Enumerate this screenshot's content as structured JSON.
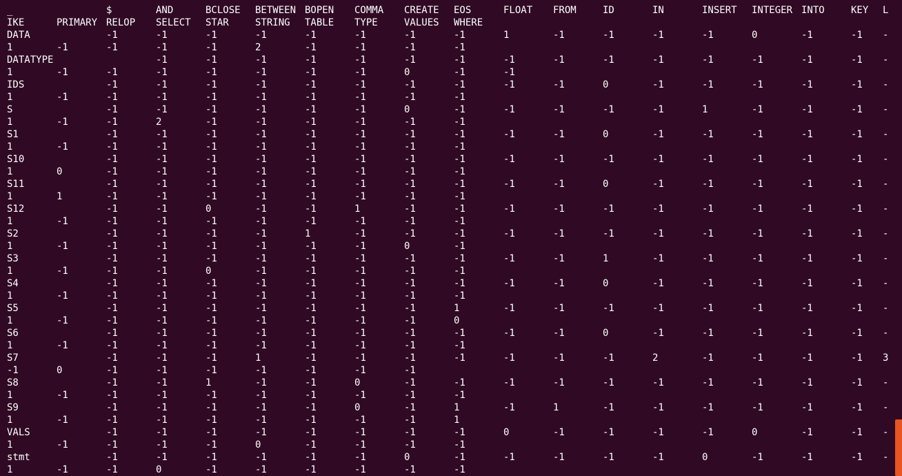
{
  "colors": {
    "background": "#300a24",
    "text": "#ffffff",
    "scrollbar": "#e95420"
  },
  "lines": [
    {
      "type": "header",
      "cells": [
        "_",
        "",
        "$",
        "AND",
        "BCLOSE",
        "BETWEEN",
        "BOPEN",
        "COMMA",
        "CREATE",
        "EOS",
        "FLOAT",
        "FROM",
        "ID",
        "IN",
        "INSERT",
        "INTEGER",
        "INTO",
        "KEY",
        "L"
      ]
    },
    {
      "type": "header",
      "cells": [
        "IKE",
        "PRIMARY",
        "RELOP",
        "SELECT",
        "STAR",
        "STRING",
        "TABLE",
        "TYPE",
        "VALUES",
        "WHERE"
      ]
    },
    {
      "type": "row-a",
      "cells": [
        "DATA",
        "",
        "-1",
        "-1",
        "-1",
        "-1",
        "-1",
        "-1",
        "-1",
        "-1",
        "1",
        "-1",
        "-1",
        "-1",
        "-1",
        "0",
        "-1",
        "-1",
        "-"
      ]
    },
    {
      "type": "row-b",
      "cells": [
        "1",
        "-1",
        "-1",
        "-1",
        "-1",
        "2",
        "-1",
        "-1",
        "-1",
        "-1"
      ]
    },
    {
      "type": "row-a",
      "cells": [
        "DATATYPE",
        "",
        "",
        "-1",
        "-1",
        "-1",
        "-1",
        "-1",
        "-1",
        "-1",
        "-1",
        "-1",
        "-1",
        "-1",
        "-1",
        "-1",
        "-1",
        "-1",
        "-"
      ]
    },
    {
      "type": "row-b",
      "cells": [
        "1",
        "-1",
        "-1",
        "-1",
        "-1",
        "-1",
        "-1",
        "-1",
        "0",
        "-1",
        "-1"
      ]
    },
    {
      "type": "row-a",
      "cells": [
        "IDS",
        "",
        "-1",
        "-1",
        "-1",
        "-1",
        "-1",
        "-1",
        "-1",
        "-1",
        "-1",
        "-1",
        "0",
        "-1",
        "-1",
        "-1",
        "-1",
        "-1",
        "-"
      ]
    },
    {
      "type": "row-b",
      "cells": [
        "1",
        "-1",
        "-1",
        "-1",
        "-1",
        "-1",
        "-1",
        "-1",
        "-1",
        "-1"
      ]
    },
    {
      "type": "row-a",
      "cells": [
        "S",
        "",
        "-1",
        "-1",
        "-1",
        "-1",
        "-1",
        "-1",
        "0",
        "-1",
        "-1",
        "-1",
        "-1",
        "-1",
        "1",
        "-1",
        "-1",
        "-1",
        "-"
      ]
    },
    {
      "type": "row-b",
      "cells": [
        "1",
        "-1",
        "-1",
        "2",
        "-1",
        "-1",
        "-1",
        "-1",
        "-1",
        "-1"
      ]
    },
    {
      "type": "row-a",
      "cells": [
        "S1",
        "",
        "-1",
        "-1",
        "-1",
        "-1",
        "-1",
        "-1",
        "-1",
        "-1",
        "-1",
        "-1",
        "0",
        "-1",
        "-1",
        "-1",
        "-1",
        "-1",
        "-"
      ]
    },
    {
      "type": "row-b",
      "cells": [
        "1",
        "-1",
        "-1",
        "-1",
        "-1",
        "-1",
        "-1",
        "-1",
        "-1",
        "-1"
      ]
    },
    {
      "type": "row-a",
      "cells": [
        "S10",
        "",
        "-1",
        "-1",
        "-1",
        "-1",
        "-1",
        "-1",
        "-1",
        "-1",
        "-1",
        "-1",
        "-1",
        "-1",
        "-1",
        "-1",
        "-1",
        "-1",
        "-"
      ]
    },
    {
      "type": "row-b",
      "cells": [
        "1",
        "0",
        "-1",
        "-1",
        "-1",
        "-1",
        "-1",
        "-1",
        "-1",
        "-1"
      ]
    },
    {
      "type": "row-a",
      "cells": [
        "S11",
        "",
        "-1",
        "-1",
        "-1",
        "-1",
        "-1",
        "-1",
        "-1",
        "-1",
        "-1",
        "-1",
        "0",
        "-1",
        "-1",
        "-1",
        "-1",
        "-1",
        "-"
      ]
    },
    {
      "type": "row-b",
      "cells": [
        "1",
        "1",
        "-1",
        "-1",
        "-1",
        "-1",
        "-1",
        "-1",
        "-1",
        "-1"
      ]
    },
    {
      "type": "row-a",
      "cells": [
        "S12",
        "",
        "-1",
        "-1",
        "0",
        "-1",
        "-1",
        "1",
        "-1",
        "-1",
        "-1",
        "-1",
        "-1",
        "-1",
        "-1",
        "-1",
        "-1",
        "-1",
        "-"
      ]
    },
    {
      "type": "row-b",
      "cells": [
        "1",
        "-1",
        "-1",
        "-1",
        "-1",
        "-1",
        "-1",
        "-1",
        "-1",
        "-1"
      ]
    },
    {
      "type": "row-a",
      "cells": [
        "S2",
        "",
        "-1",
        "-1",
        "-1",
        "-1",
        "1",
        "-1",
        "-1",
        "-1",
        "-1",
        "-1",
        "-1",
        "-1",
        "-1",
        "-1",
        "-1",
        "-1",
        "-"
      ]
    },
    {
      "type": "row-b",
      "cells": [
        "1",
        "-1",
        "-1",
        "-1",
        "-1",
        "-1",
        "-1",
        "-1",
        "0",
        "-1"
      ]
    },
    {
      "type": "row-a",
      "cells": [
        "S3",
        "",
        "-1",
        "-1",
        "-1",
        "-1",
        "-1",
        "-1",
        "-1",
        "-1",
        "-1",
        "-1",
        "1",
        "-1",
        "-1",
        "-1",
        "-1",
        "-1",
        "-"
      ]
    },
    {
      "type": "row-b",
      "cells": [
        "1",
        "-1",
        "-1",
        "-1",
        "0",
        "-1",
        "-1",
        "-1",
        "-1",
        "-1"
      ]
    },
    {
      "type": "row-a",
      "cells": [
        "S4",
        "",
        "-1",
        "-1",
        "-1",
        "-1",
        "-1",
        "-1",
        "-1",
        "-1",
        "-1",
        "-1",
        "0",
        "-1",
        "-1",
        "-1",
        "-1",
        "-1",
        "-"
      ]
    },
    {
      "type": "row-b",
      "cells": [
        "1",
        "-1",
        "-1",
        "-1",
        "-1",
        "-1",
        "-1",
        "-1",
        "-1",
        "-1"
      ]
    },
    {
      "type": "row-a",
      "cells": [
        "S5",
        "",
        "-1",
        "-1",
        "-1",
        "-1",
        "-1",
        "-1",
        "-1",
        "1",
        "-1",
        "-1",
        "-1",
        "-1",
        "-1",
        "-1",
        "-1",
        "-1",
        "-"
      ]
    },
    {
      "type": "row-b",
      "cells": [
        "1",
        "-1",
        "-1",
        "-1",
        "-1",
        "-1",
        "-1",
        "-1",
        "-1",
        "0"
      ]
    },
    {
      "type": "row-a",
      "cells": [
        "S6",
        "",
        "-1",
        "-1",
        "-1",
        "-1",
        "-1",
        "-1",
        "-1",
        "-1",
        "-1",
        "-1",
        "0",
        "-1",
        "-1",
        "-1",
        "-1",
        "-1",
        "-"
      ]
    },
    {
      "type": "row-b",
      "cells": [
        "1",
        "-1",
        "-1",
        "-1",
        "-1",
        "-1",
        "-1",
        "-1",
        "-1",
        "-1"
      ]
    },
    {
      "type": "row-a",
      "cells": [
        "S7",
        "",
        "-1",
        "-1",
        "-1",
        "1",
        "-1",
        "-1",
        "-1",
        "-1",
        "-1",
        "-1",
        "-1",
        "2",
        "-1",
        "-1",
        "-1",
        "-1",
        "3"
      ]
    },
    {
      "type": "row-b",
      "cells": [
        "-1",
        "0",
        "-1",
        "-1",
        "-1",
        "-1",
        "-1",
        "-1",
        "-1",
        ""
      ]
    },
    {
      "type": "row-a",
      "cells": [
        "S8",
        "",
        "-1",
        "-1",
        "1",
        "-1",
        "-1",
        "0",
        "-1",
        "-1",
        "-1",
        "-1",
        "-1",
        "-1",
        "-1",
        "-1",
        "-1",
        "-1",
        "-"
      ]
    },
    {
      "type": "row-b",
      "cells": [
        "1",
        "-1",
        "-1",
        "-1",
        "-1",
        "-1",
        "-1",
        "-1",
        "-1",
        "-1"
      ]
    },
    {
      "type": "row-a",
      "cells": [
        "S9",
        "",
        "-1",
        "-1",
        "-1",
        "-1",
        "-1",
        "0",
        "-1",
        "1",
        "-1",
        "1",
        "-1",
        "-1",
        "-1",
        "-1",
        "-1",
        "-1",
        "-"
      ]
    },
    {
      "type": "row-b",
      "cells": [
        "1",
        "-1",
        "-1",
        "-1",
        "-1",
        "-1",
        "-1",
        "-1",
        "-1",
        "1"
      ]
    },
    {
      "type": "row-a",
      "cells": [
        "VALS",
        "",
        "-1",
        "-1",
        "-1",
        "-1",
        "-1",
        "-1",
        "-1",
        "-1",
        "0",
        "-1",
        "-1",
        "-1",
        "-1",
        "0",
        "-1",
        "-1",
        "-"
      ]
    },
    {
      "type": "row-b",
      "cells": [
        "1",
        "-1",
        "-1",
        "-1",
        "-1",
        "0",
        "-1",
        "-1",
        "-1",
        "-1"
      ]
    },
    {
      "type": "row-a",
      "cells": [
        "stmt",
        "",
        "-1",
        "-1",
        "-1",
        "-1",
        "-1",
        "-1",
        "0",
        "-1",
        "-1",
        "-1",
        "-1",
        "-1",
        "0",
        "-1",
        "-1",
        "-1",
        "-"
      ]
    },
    {
      "type": "row-b",
      "cells": [
        "1",
        "-1",
        "-1",
        "0",
        "-1",
        "-1",
        "-1",
        "-1",
        "-1",
        "-1"
      ]
    }
  ]
}
